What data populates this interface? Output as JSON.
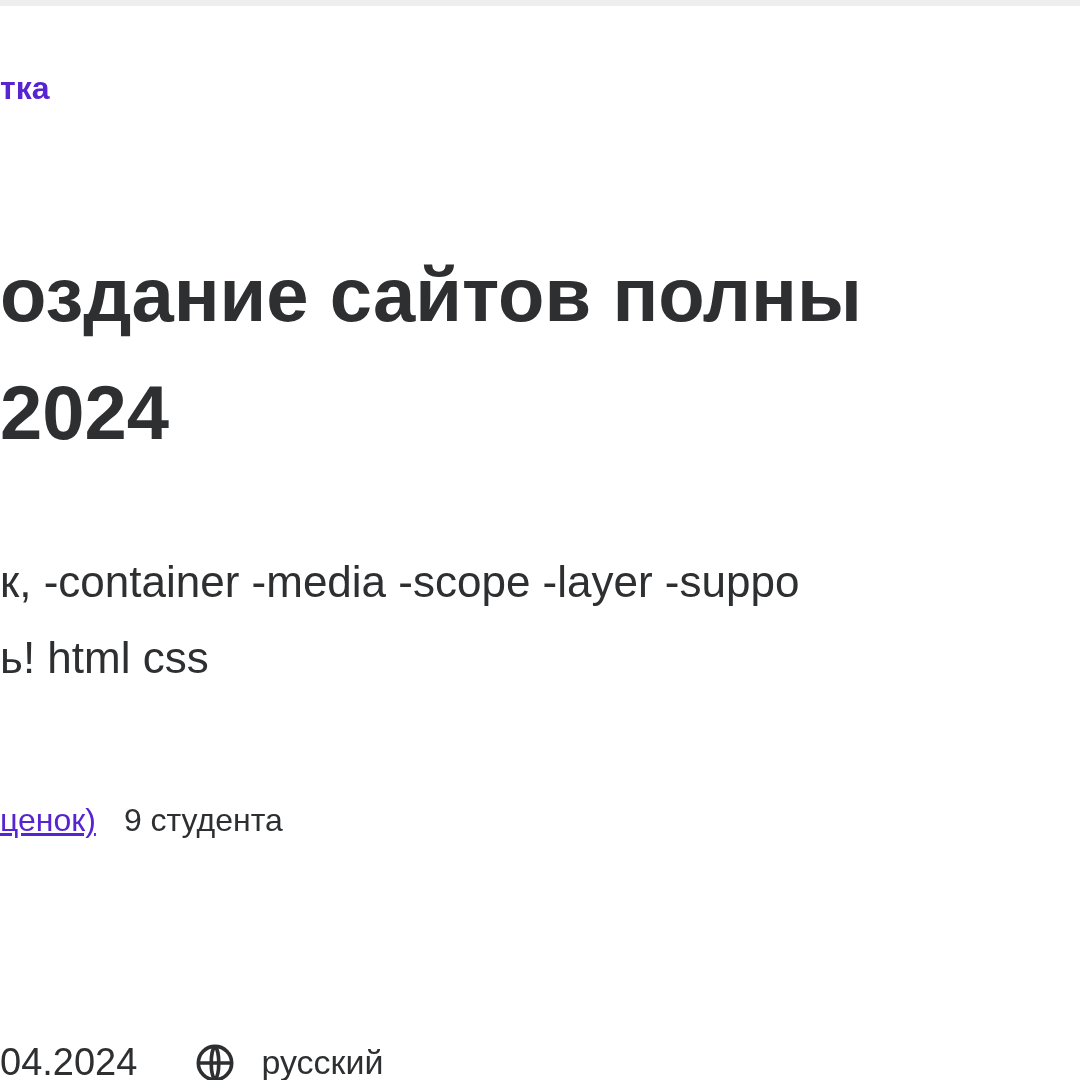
{
  "breadcrumb": "тка",
  "title_lines": [
    "оздание сайтов полны",
    "2024"
  ],
  "subtitle_lines": [
    "к, -container -media -scope -layer -suppo",
    "ь! html css"
  ],
  "rating_link": "ценок)",
  "students": "9 студента",
  "updated": "04.2024",
  "language": "русский"
}
